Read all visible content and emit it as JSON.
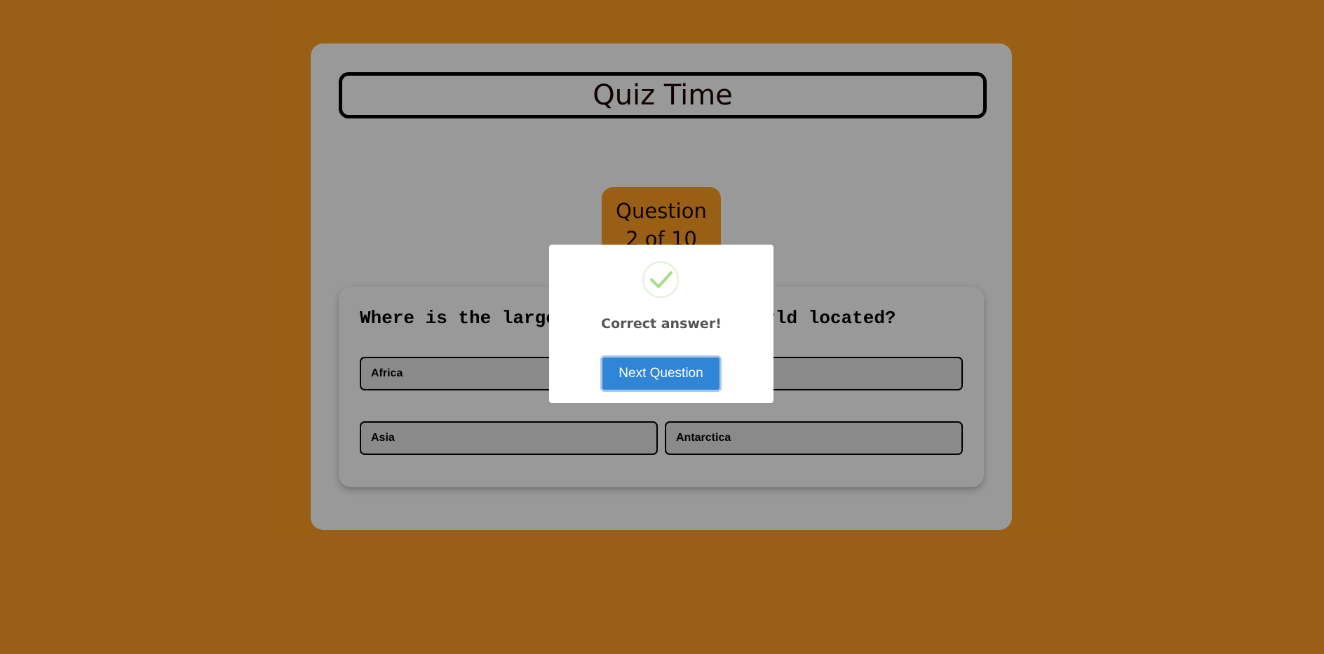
{
  "quiz": {
    "title": "Quiz Time",
    "counter_line1": "Question",
    "counter_line2": "2 of 10",
    "question": "Where is the largest desert in the world located?",
    "answers": [
      "Africa",
      "Asia",
      "Antarctica"
    ]
  },
  "dialog": {
    "icon": "success-check-icon",
    "message": "Correct answer!",
    "button_label": "Next Question"
  },
  "colors": {
    "background": "#ff9f24",
    "card": "#ffffff",
    "button": "#3085d6",
    "check": "#a5dc86"
  }
}
